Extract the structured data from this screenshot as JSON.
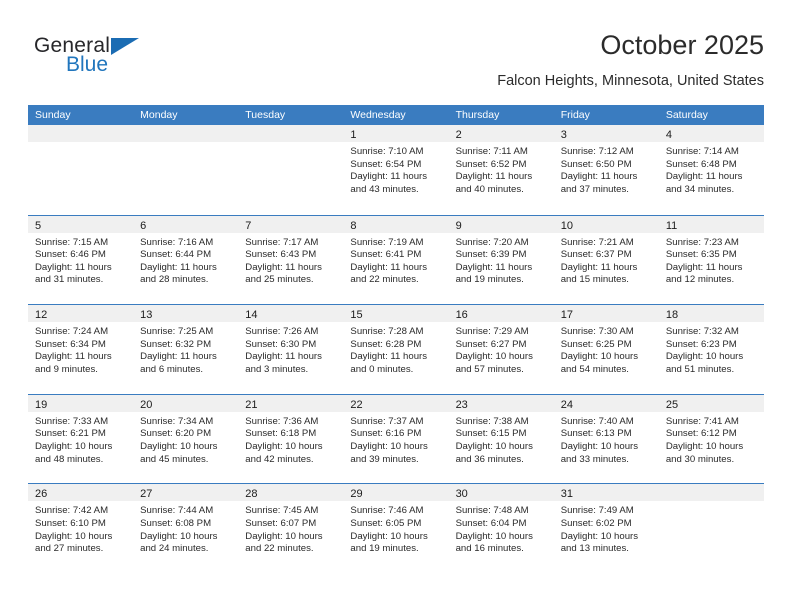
{
  "brand": {
    "name_top": "General",
    "name_bottom": "Blue",
    "color_dark": "#27272a",
    "color_blue": "#2176bd"
  },
  "header": {
    "title": "October 2025",
    "subtitle": "Falcon Heights, Minnesota, United States"
  },
  "theme": {
    "header_bg": "#3a7cc0",
    "day_band_bg": "#f0f0f0",
    "row_rule": "#3a7cc0",
    "text": "#2a2a2a"
  },
  "labels": {
    "sunrise_prefix": "Sunrise:",
    "sunset_prefix": "Sunset:",
    "daylight_prefix": "Daylight:"
  },
  "weekdays": [
    "Sunday",
    "Monday",
    "Tuesday",
    "Wednesday",
    "Thursday",
    "Friday",
    "Saturday"
  ],
  "weeks": [
    [
      {
        "day": "",
        "sunrise": "",
        "sunset": "",
        "daylight_line1": "",
        "daylight_line2": ""
      },
      {
        "day": "",
        "sunrise": "",
        "sunset": "",
        "daylight_line1": "",
        "daylight_line2": ""
      },
      {
        "day": "",
        "sunrise": "",
        "sunset": "",
        "daylight_line1": "",
        "daylight_line2": ""
      },
      {
        "day": "1",
        "sunrise": "Sunrise: 7:10 AM",
        "sunset": "Sunset: 6:54 PM",
        "daylight_line1": "Daylight: 11 hours",
        "daylight_line2": "and 43 minutes."
      },
      {
        "day": "2",
        "sunrise": "Sunrise: 7:11 AM",
        "sunset": "Sunset: 6:52 PM",
        "daylight_line1": "Daylight: 11 hours",
        "daylight_line2": "and 40 minutes."
      },
      {
        "day": "3",
        "sunrise": "Sunrise: 7:12 AM",
        "sunset": "Sunset: 6:50 PM",
        "daylight_line1": "Daylight: 11 hours",
        "daylight_line2": "and 37 minutes."
      },
      {
        "day": "4",
        "sunrise": "Sunrise: 7:14 AM",
        "sunset": "Sunset: 6:48 PM",
        "daylight_line1": "Daylight: 11 hours",
        "daylight_line2": "and 34 minutes."
      }
    ],
    [
      {
        "day": "5",
        "sunrise": "Sunrise: 7:15 AM",
        "sunset": "Sunset: 6:46 PM",
        "daylight_line1": "Daylight: 11 hours",
        "daylight_line2": "and 31 minutes."
      },
      {
        "day": "6",
        "sunrise": "Sunrise: 7:16 AM",
        "sunset": "Sunset: 6:44 PM",
        "daylight_line1": "Daylight: 11 hours",
        "daylight_line2": "and 28 minutes."
      },
      {
        "day": "7",
        "sunrise": "Sunrise: 7:17 AM",
        "sunset": "Sunset: 6:43 PM",
        "daylight_line1": "Daylight: 11 hours",
        "daylight_line2": "and 25 minutes."
      },
      {
        "day": "8",
        "sunrise": "Sunrise: 7:19 AM",
        "sunset": "Sunset: 6:41 PM",
        "daylight_line1": "Daylight: 11 hours",
        "daylight_line2": "and 22 minutes."
      },
      {
        "day": "9",
        "sunrise": "Sunrise: 7:20 AM",
        "sunset": "Sunset: 6:39 PM",
        "daylight_line1": "Daylight: 11 hours",
        "daylight_line2": "and 19 minutes."
      },
      {
        "day": "10",
        "sunrise": "Sunrise: 7:21 AM",
        "sunset": "Sunset: 6:37 PM",
        "daylight_line1": "Daylight: 11 hours",
        "daylight_line2": "and 15 minutes."
      },
      {
        "day": "11",
        "sunrise": "Sunrise: 7:23 AM",
        "sunset": "Sunset: 6:35 PM",
        "daylight_line1": "Daylight: 11 hours",
        "daylight_line2": "and 12 minutes."
      }
    ],
    [
      {
        "day": "12",
        "sunrise": "Sunrise: 7:24 AM",
        "sunset": "Sunset: 6:34 PM",
        "daylight_line1": "Daylight: 11 hours",
        "daylight_line2": "and 9 minutes."
      },
      {
        "day": "13",
        "sunrise": "Sunrise: 7:25 AM",
        "sunset": "Sunset: 6:32 PM",
        "daylight_line1": "Daylight: 11 hours",
        "daylight_line2": "and 6 minutes."
      },
      {
        "day": "14",
        "sunrise": "Sunrise: 7:26 AM",
        "sunset": "Sunset: 6:30 PM",
        "daylight_line1": "Daylight: 11 hours",
        "daylight_line2": "and 3 minutes."
      },
      {
        "day": "15",
        "sunrise": "Sunrise: 7:28 AM",
        "sunset": "Sunset: 6:28 PM",
        "daylight_line1": "Daylight: 11 hours",
        "daylight_line2": "and 0 minutes."
      },
      {
        "day": "16",
        "sunrise": "Sunrise: 7:29 AM",
        "sunset": "Sunset: 6:27 PM",
        "daylight_line1": "Daylight: 10 hours",
        "daylight_line2": "and 57 minutes."
      },
      {
        "day": "17",
        "sunrise": "Sunrise: 7:30 AM",
        "sunset": "Sunset: 6:25 PM",
        "daylight_line1": "Daylight: 10 hours",
        "daylight_line2": "and 54 minutes."
      },
      {
        "day": "18",
        "sunrise": "Sunrise: 7:32 AM",
        "sunset": "Sunset: 6:23 PM",
        "daylight_line1": "Daylight: 10 hours",
        "daylight_line2": "and 51 minutes."
      }
    ],
    [
      {
        "day": "19",
        "sunrise": "Sunrise: 7:33 AM",
        "sunset": "Sunset: 6:21 PM",
        "daylight_line1": "Daylight: 10 hours",
        "daylight_line2": "and 48 minutes."
      },
      {
        "day": "20",
        "sunrise": "Sunrise: 7:34 AM",
        "sunset": "Sunset: 6:20 PM",
        "daylight_line1": "Daylight: 10 hours",
        "daylight_line2": "and 45 minutes."
      },
      {
        "day": "21",
        "sunrise": "Sunrise: 7:36 AM",
        "sunset": "Sunset: 6:18 PM",
        "daylight_line1": "Daylight: 10 hours",
        "daylight_line2": "and 42 minutes."
      },
      {
        "day": "22",
        "sunrise": "Sunrise: 7:37 AM",
        "sunset": "Sunset: 6:16 PM",
        "daylight_line1": "Daylight: 10 hours",
        "daylight_line2": "and 39 minutes."
      },
      {
        "day": "23",
        "sunrise": "Sunrise: 7:38 AM",
        "sunset": "Sunset: 6:15 PM",
        "daylight_line1": "Daylight: 10 hours",
        "daylight_line2": "and 36 minutes."
      },
      {
        "day": "24",
        "sunrise": "Sunrise: 7:40 AM",
        "sunset": "Sunset: 6:13 PM",
        "daylight_line1": "Daylight: 10 hours",
        "daylight_line2": "and 33 minutes."
      },
      {
        "day": "25",
        "sunrise": "Sunrise: 7:41 AM",
        "sunset": "Sunset: 6:12 PM",
        "daylight_line1": "Daylight: 10 hours",
        "daylight_line2": "and 30 minutes."
      }
    ],
    [
      {
        "day": "26",
        "sunrise": "Sunrise: 7:42 AM",
        "sunset": "Sunset: 6:10 PM",
        "daylight_line1": "Daylight: 10 hours",
        "daylight_line2": "and 27 minutes."
      },
      {
        "day": "27",
        "sunrise": "Sunrise: 7:44 AM",
        "sunset": "Sunset: 6:08 PM",
        "daylight_line1": "Daylight: 10 hours",
        "daylight_line2": "and 24 minutes."
      },
      {
        "day": "28",
        "sunrise": "Sunrise: 7:45 AM",
        "sunset": "Sunset: 6:07 PM",
        "daylight_line1": "Daylight: 10 hours",
        "daylight_line2": "and 22 minutes."
      },
      {
        "day": "29",
        "sunrise": "Sunrise: 7:46 AM",
        "sunset": "Sunset: 6:05 PM",
        "daylight_line1": "Daylight: 10 hours",
        "daylight_line2": "and 19 minutes."
      },
      {
        "day": "30",
        "sunrise": "Sunrise: 7:48 AM",
        "sunset": "Sunset: 6:04 PM",
        "daylight_line1": "Daylight: 10 hours",
        "daylight_line2": "and 16 minutes."
      },
      {
        "day": "31",
        "sunrise": "Sunrise: 7:49 AM",
        "sunset": "Sunset: 6:02 PM",
        "daylight_line1": "Daylight: 10 hours",
        "daylight_line2": "and 13 minutes."
      },
      {
        "day": "",
        "sunrise": "",
        "sunset": "",
        "daylight_line1": "",
        "daylight_line2": ""
      }
    ]
  ]
}
